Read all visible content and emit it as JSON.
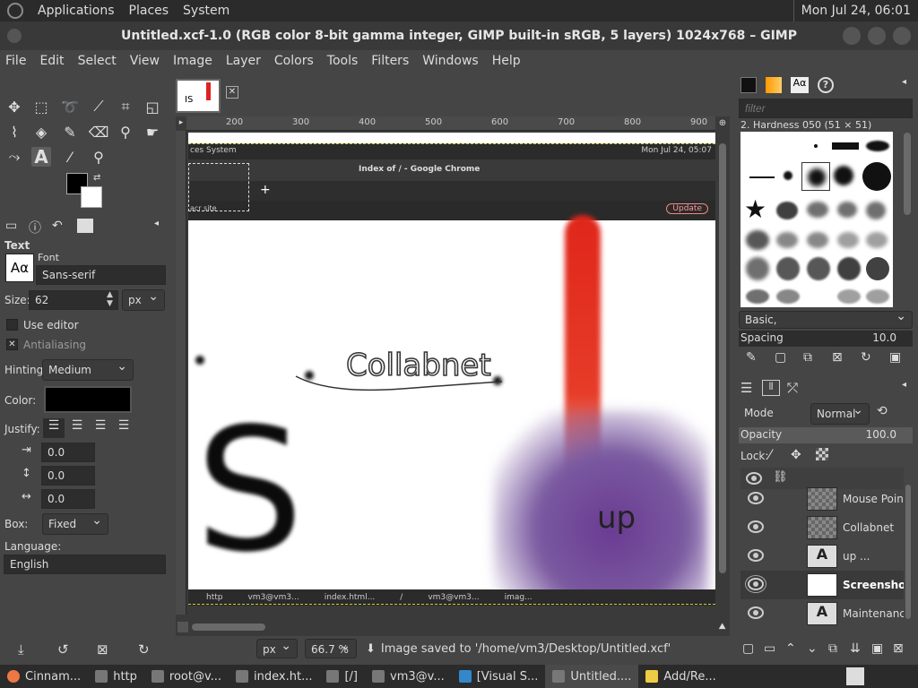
{
  "topbar": {
    "menus": [
      "Applications",
      "Places",
      "System"
    ],
    "clock": "Mon Jul 24, 06:01"
  },
  "window": {
    "title": "Untitled.xcf-1.0 (RGB color 8-bit gamma integer, GIMP built-in sRGB, 5 layers) 1024x768 – GIMP"
  },
  "menubar": [
    "File",
    "Edit",
    "Select",
    "View",
    "Image",
    "Layer",
    "Colors",
    "Tools",
    "Filters",
    "Windows",
    "Help"
  ],
  "tool_options": {
    "heading": "Text",
    "font_label": "Font",
    "font_value": "Sans-serif",
    "size_label": "Size:",
    "size_value": "62",
    "size_unit": "px",
    "use_editor": "Use editor",
    "antialiasing": "Antialiasing",
    "hinting_label": "Hinting:",
    "hinting_value": "Medium",
    "color_label": "Color:",
    "justify_label": "Justify:",
    "indent_value": "0.0",
    "line_spacing_value": "0.0",
    "letter_spacing_value": "0.0",
    "box_label": "Box:",
    "box_value": "Fixed",
    "language_label": "Language:",
    "language_value": "English"
  },
  "canvas": {
    "ruler_ticks": [
      "200",
      "300",
      "400",
      "500",
      "600",
      "700",
      "800",
      "900"
    ],
    "inner_topbar_left": "ces  System",
    "inner_topbar_right": "Mon Jul 24, 05:07",
    "inner_chrome_title": "Index of / - Google Chrome",
    "inner_update": "Update",
    "inner_tab_fragment": "acr site",
    "collabnet_text": "Collabnet",
    "up_text": "up",
    "big_text": "IS",
    "inner_taskbar": [
      "http",
      "vm3@vm3...",
      "index.html...",
      "/",
      "vm3@vm3...",
      "imag..."
    ]
  },
  "statusbar": {
    "unit": "px",
    "zoom": "66.7 %",
    "message": "Image saved to '/home/vm3/Desktop/Untitled.xcf'"
  },
  "brushes": {
    "filter_placeholder": "filter",
    "brush_name": "2. Hardness 050 (51 × 51)",
    "preset": "Basic,",
    "spacing_label": "Spacing",
    "spacing_value": "10.0"
  },
  "layers": {
    "mode_label": "Mode",
    "mode_value": "Normal",
    "opacity_label": "Opacity",
    "opacity_value": "100.0",
    "lock_label": "Lock:",
    "items": [
      {
        "name": "Mouse Pointe"
      },
      {
        "name": "Collabnet"
      },
      {
        "name": "up ..."
      },
      {
        "name": "Screenshot"
      },
      {
        "name": "Maintenance"
      }
    ]
  },
  "taskbar": {
    "items": [
      "Cinnam...",
      "http",
      "root@v...",
      "index.ht...",
      "[/]",
      "vm3@v...",
      "[Visual S...",
      "Untitled....",
      "Add/Re..."
    ]
  }
}
